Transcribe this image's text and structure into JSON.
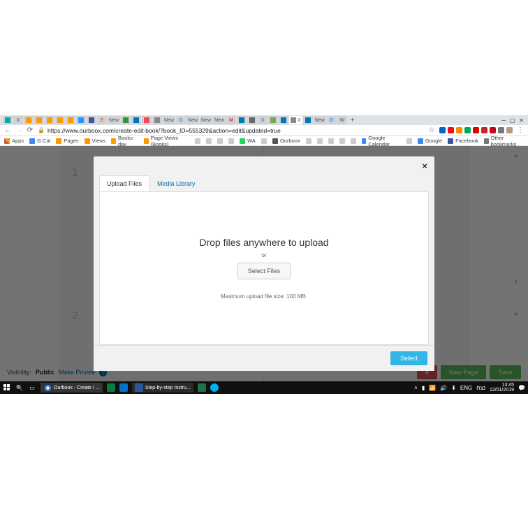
{
  "browser": {
    "url": "https://www.ourboox.com/create-edit-book/?book_ID=555329&action=edit&updated=true",
    "protocol_https": "https",
    "tabs": [
      "",
      "X",
      "",
      "",
      "",
      "",
      "",
      "",
      "",
      "E",
      "New",
      "",
      "",
      "",
      "",
      "New",
      "G",
      "New",
      "New",
      "New",
      "M",
      "in",
      "",
      "X",
      "",
      "",
      "",
      "in",
      "New",
      "G",
      "W"
    ],
    "active_tab_label": "X",
    "new_tab": "+"
  },
  "bookmarks": {
    "apps": "Apps",
    "items": [
      "G.Cal",
      "Pages",
      "Views",
      "Books-day",
      "Page Views (Books)",
      "",
      "",
      "",
      "",
      "",
      "WA",
      "",
      "Ourboox",
      "",
      "",
      "",
      "",
      "",
      "Google Calendar",
      "",
      "Google",
      "Facebook"
    ],
    "other": "Other bookmarks"
  },
  "page": {
    "num1": "1",
    "num2": "2",
    "visibility_label": "Visibility:",
    "visibility_value": "Public",
    "make_private": "Make Private",
    "btn_e": "e",
    "btn_newpage": "New Page",
    "btn_save": "Save"
  },
  "modal": {
    "tab_upload": "Upload Files",
    "tab_media": "Media Library",
    "drop_title": "Drop files anywhere to upload",
    "or": "or",
    "select_files": "Select Files",
    "max_size": "Maximum upload file size: 100 MB.",
    "select": "Select"
  },
  "taskbar": {
    "app_chrome": "Ourboox - Create / ...",
    "app_word": "Step-by-step Instru...",
    "lang": "ENG",
    "kbd": "נצח",
    "time": "13:45",
    "date": "12/01/2019"
  }
}
